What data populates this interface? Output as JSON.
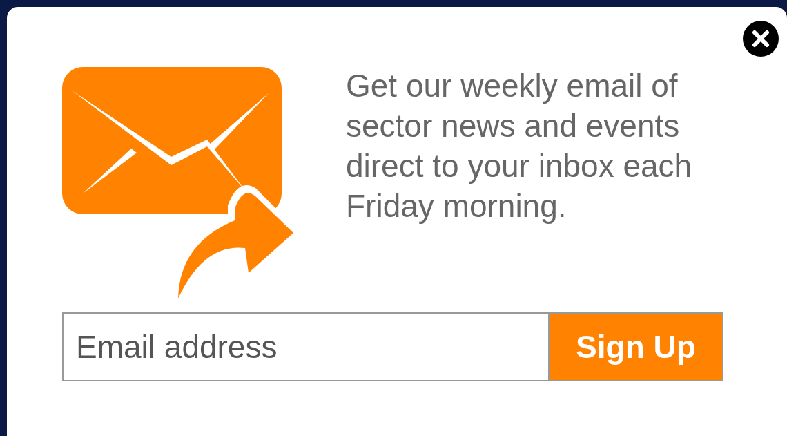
{
  "message": "Get our weekly email of sector news and events direct to your inbox each Friday morning.",
  "email_field": {
    "placeholder": "Email address"
  },
  "signup_button": {
    "label": "Sign Up"
  }
}
